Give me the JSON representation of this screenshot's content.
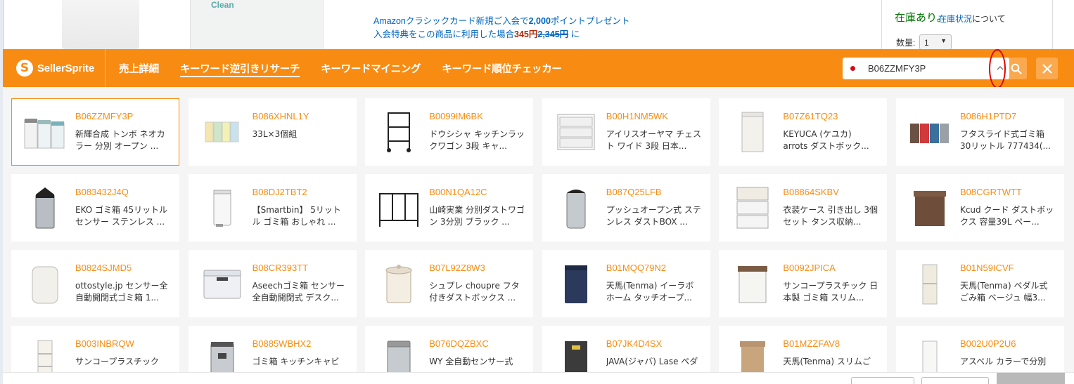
{
  "background_page": {
    "img_label": "Clean",
    "promo_line1_pre": "Amazonクラシックカード新規ご入会で",
    "promo_points": "2,000",
    "promo_line1_post": "ポイントプレゼント",
    "promo_line2_pre": "入会特典をこの商品に利用した場合",
    "promo_price": "345円",
    "promo_strike": "2,345円",
    "promo_line2_post": "に",
    "stock_text": "在庫あり。",
    "stock_link": "在庫状況",
    "stock_link_post": "について",
    "qty_label": "数量:",
    "qty_value": "1"
  },
  "toolbar": {
    "logo_text": "SellerSprite",
    "nav": [
      {
        "label": "売上詳細",
        "active": false
      },
      {
        "label": "キーワード逆引きリサーチ",
        "active": true
      },
      {
        "label": "キーワードマイニング",
        "active": false
      },
      {
        "label": "キーワード順位チェッカー",
        "active": false
      }
    ],
    "search_value": "B06ZZMFY3P",
    "marketplace_color": "#d00e1e",
    "accent_color": "#f88c13"
  },
  "products": [
    {
      "asin": "B06ZZMFY3P",
      "title": "新輝合成 トンボ ネオカラー 分別 オープン ...",
      "icon": "three-bins-icon",
      "selected": true
    },
    {
      "asin": "B086XHNL1Y",
      "title": "33L×3個組",
      "icon": "pastel-bins-icon",
      "selected": false
    },
    {
      "asin": "B0099IM6BK",
      "title": "ドウシシャ キッチンラックワゴン 3段 キャ...",
      "icon": "wagon-rack-icon",
      "selected": false
    },
    {
      "asin": "B00H1NM5WK",
      "title": "アイリスオーヤマ チェスト ワイド 3段 日本...",
      "icon": "chest-drawer-icon",
      "selected": false
    },
    {
      "asin": "B07Z61TQ23",
      "title": "KEYUCA (ケユカ) arrots ダストボック...",
      "icon": "white-bin-icon",
      "selected": false
    },
    {
      "asin": "B086H1PTD7",
      "title": "フタスライド式ゴミ箱 30リットル 777434(...",
      "icon": "color-bins-icon",
      "selected": false
    },
    {
      "asin": "B083432J4Q",
      "title": "EKO ゴミ箱 45リットル センサー ステンレス ...",
      "icon": "steel-bin-icon",
      "selected": false
    },
    {
      "asin": "B08DJ2TBT2",
      "title": "【Smartbin】 5リットル ゴミ箱 おしゃれ ...",
      "icon": "pedal-bin-icon",
      "selected": false
    },
    {
      "asin": "B00N1QA12C",
      "title": "山崎実業 分別ダストワゴン 3分別 ブラック ...",
      "icon": "bag-rack-icon",
      "selected": false
    },
    {
      "asin": "B087Q25LFB",
      "title": "プッシュオープン式 ステンレス ダストBOX ...",
      "icon": "push-bin-icon",
      "selected": false
    },
    {
      "asin": "B08864SKBV",
      "title": "衣装ケース 引き出し 3個セット タンス収納...",
      "icon": "storage-case-icon",
      "selected": false
    },
    {
      "asin": "B08CGRTWTT",
      "title": "Kcud クード ダストボックス 容量39L ペー...",
      "icon": "brown-bin-icon",
      "selected": false
    },
    {
      "asin": "B0824SJMD5",
      "title": "ottostyle.jp センサー全自動開閉式ゴミ箱 1...",
      "icon": "round-bin-icon",
      "selected": false
    },
    {
      "asin": "B08CR393TT",
      "title": "Aseechゴミ箱 センサー全自動開閉式 デスク...",
      "icon": "desk-bin-icon",
      "selected": false
    },
    {
      "asin": "B07L92Z8W3",
      "title": "シュプレ choupre フタ付きダストボックス ...",
      "icon": "cream-pail-icon",
      "selected": false
    },
    {
      "asin": "B01MQQ79N2",
      "title": "天馬(Tenma) イーラボ ホーム タッチオープ...",
      "icon": "navy-bin-icon",
      "selected": false
    },
    {
      "asin": "B0092JPICA",
      "title": "サンコープラスチック 日本製 ゴミ箱 スリム...",
      "icon": "slim-bin-icon",
      "selected": false
    },
    {
      "asin": "B01N59ICVF",
      "title": "天馬(Tenma) ペダル式 ごみ箱 ベージュ 幅3...",
      "icon": "beige-bin-icon",
      "selected": false
    },
    {
      "asin": "B003INBRQW",
      "title": "サンコープラスチック",
      "icon": "stack-bin-icon",
      "selected": false
    },
    {
      "asin": "B0885WBHX2",
      "title": "ゴミ箱 キッチンキャビ",
      "icon": "cabinet-bin-icon",
      "selected": false
    },
    {
      "asin": "B076DQZBXC",
      "title": "WY 全自動センサー式",
      "icon": "sensor-bin-icon",
      "selected": false
    },
    {
      "asin": "B07JK4D4SX",
      "title": "JAVA(ジャバ) Lase ペダ",
      "icon": "black-bin-icon",
      "selected": false
    },
    {
      "asin": "B01MZZFAV8",
      "title": "天馬(Tenma) スリムご",
      "icon": "tan-bin-icon",
      "selected": false
    },
    {
      "asin": "B002U0P2U6",
      "title": "アスベル カラーで分別",
      "icon": "tall-bin-icon",
      "selected": false
    }
  ]
}
